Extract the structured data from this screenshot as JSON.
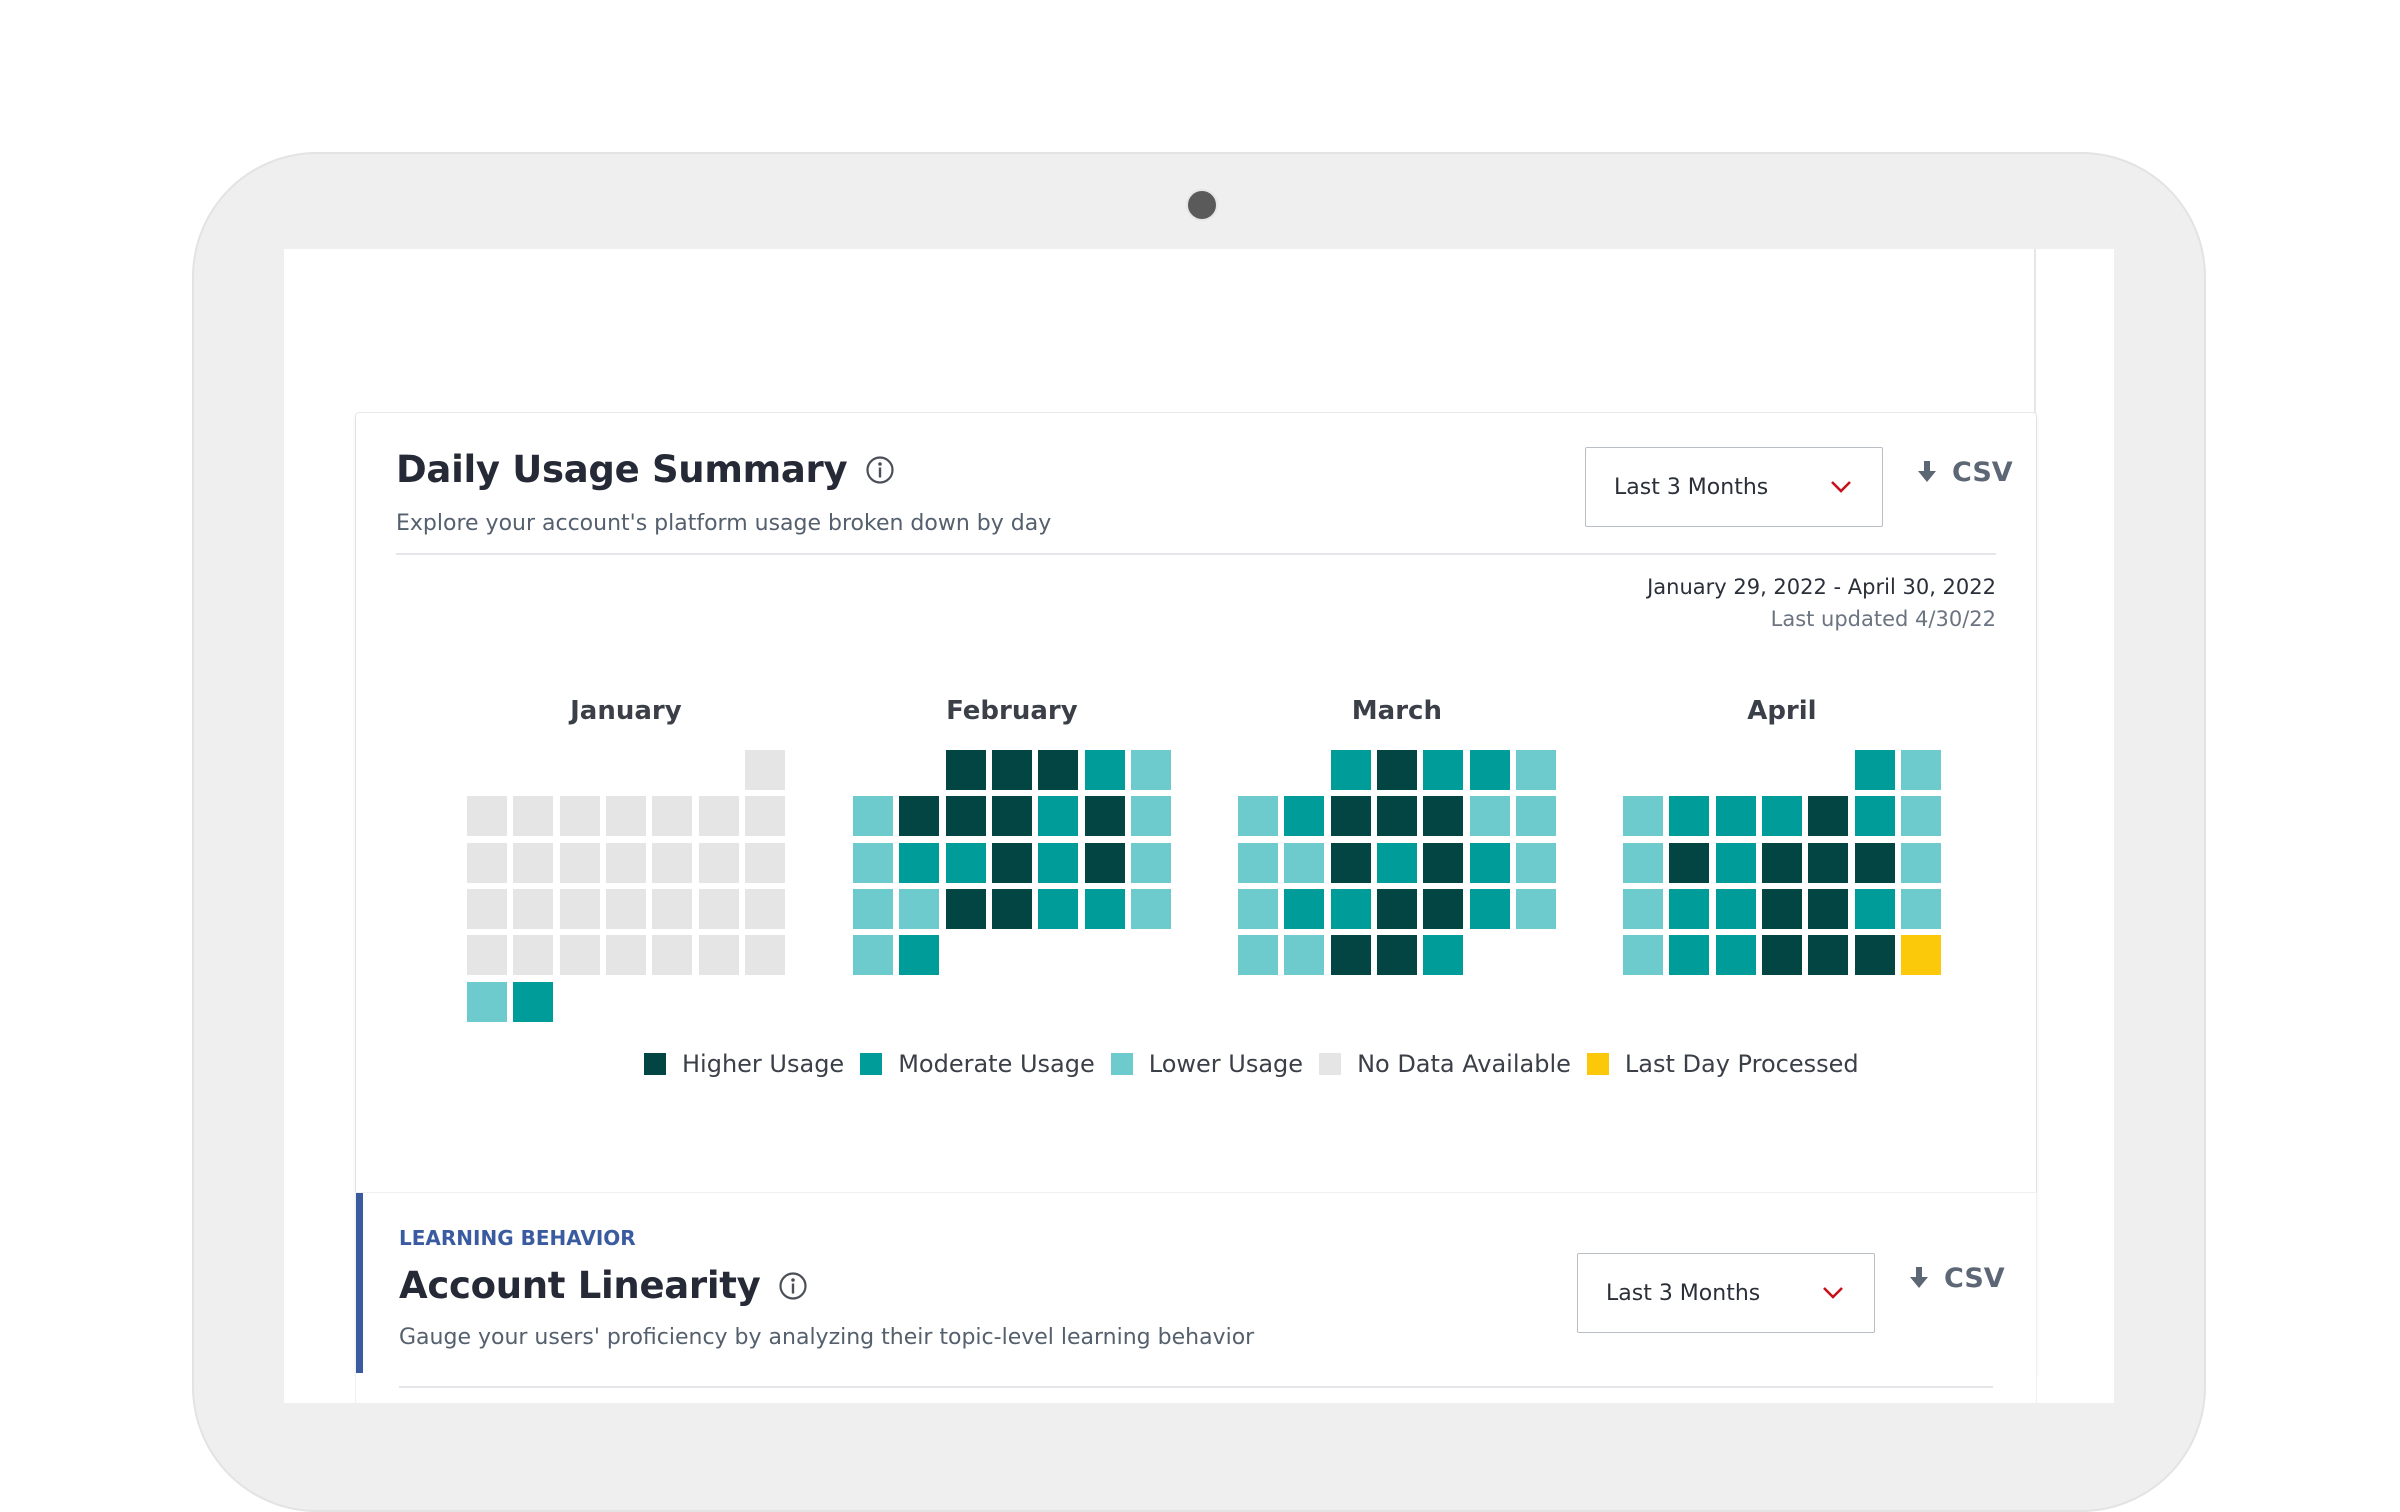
{
  "daily_usage": {
    "title": "Daily Usage Summary",
    "subtitle": "Explore your account's platform usage broken down by day",
    "range_select": "Last 3 Months",
    "csv_label": "CSV",
    "date_range": "January 29, 2022 - April 30, 2022",
    "last_updated": "Last updated 4/30/22",
    "colors": {
      "higher": "#024543",
      "moderate": "#009c9a",
      "lower": "#6ecbcd",
      "nodata": "#e5e5e5",
      "lastday": "#fbc80a"
    },
    "legend": [
      {
        "key": "higher",
        "label": "Higher Usage"
      },
      {
        "key": "moderate",
        "label": "Moderate Usage"
      },
      {
        "key": "lower",
        "label": "Lower Usage"
      },
      {
        "key": "nodata",
        "label": "No Data Available"
      },
      {
        "key": "lastday",
        "label": "Last Day Processed"
      }
    ],
    "months": [
      {
        "name": "January",
        "weeks": [
          [
            "",
            "",
            "",
            "",
            "",
            "",
            "nodata"
          ],
          [
            "nodata",
            "nodata",
            "nodata",
            "nodata",
            "nodata",
            "nodata",
            "nodata"
          ],
          [
            "nodata",
            "nodata",
            "nodata",
            "nodata",
            "nodata",
            "nodata",
            "nodata"
          ],
          [
            "nodata",
            "nodata",
            "nodata",
            "nodata",
            "nodata",
            "nodata",
            "nodata"
          ],
          [
            "nodata",
            "nodata",
            "nodata",
            "nodata",
            "nodata",
            "nodata",
            "nodata"
          ],
          [
            "lower",
            "moderate",
            "",
            "",
            "",
            "",
            ""
          ]
        ]
      },
      {
        "name": "February",
        "weeks": [
          [
            "",
            "",
            "higher",
            "higher",
            "higher",
            "moderate",
            "lower"
          ],
          [
            "lower",
            "higher",
            "higher",
            "higher",
            "moderate",
            "higher",
            "lower"
          ],
          [
            "lower",
            "moderate",
            "moderate",
            "higher",
            "moderate",
            "higher",
            "lower"
          ],
          [
            "lower",
            "lower",
            "higher",
            "higher",
            "moderate",
            "moderate",
            "lower"
          ],
          [
            "lower",
            "moderate",
            "",
            "",
            "",
            "",
            ""
          ]
        ]
      },
      {
        "name": "March",
        "weeks": [
          [
            "",
            "",
            "moderate",
            "higher",
            "moderate",
            "moderate",
            "lower"
          ],
          [
            "lower",
            "moderate",
            "higher",
            "higher",
            "higher",
            "lower",
            "lower"
          ],
          [
            "lower",
            "lower",
            "higher",
            "moderate",
            "higher",
            "moderate",
            "lower"
          ],
          [
            "lower",
            "moderate",
            "moderate",
            "higher",
            "higher",
            "moderate",
            "lower"
          ],
          [
            "lower",
            "lower",
            "higher",
            "higher",
            "moderate",
            "",
            ""
          ]
        ]
      },
      {
        "name": "April",
        "weeks": [
          [
            "",
            "",
            "",
            "",
            "",
            "moderate",
            "lower"
          ],
          [
            "lower",
            "moderate",
            "moderate",
            "moderate",
            "higher",
            "moderate",
            "lower"
          ],
          [
            "lower",
            "higher",
            "moderate",
            "higher",
            "higher",
            "higher",
            "lower"
          ],
          [
            "lower",
            "moderate",
            "moderate",
            "higher",
            "higher",
            "moderate",
            "lower"
          ],
          [
            "lower",
            "moderate",
            "moderate",
            "higher",
            "higher",
            "higher",
            "lastday"
          ]
        ]
      }
    ]
  },
  "account_linearity": {
    "eyebrow": "LEARNING BEHAVIOR",
    "title": "Account Linearity",
    "subtitle": "Gauge your users' proficiency by analyzing their topic-level learning behavior",
    "range_select": "Last 3 Months",
    "csv_label": "CSV"
  }
}
